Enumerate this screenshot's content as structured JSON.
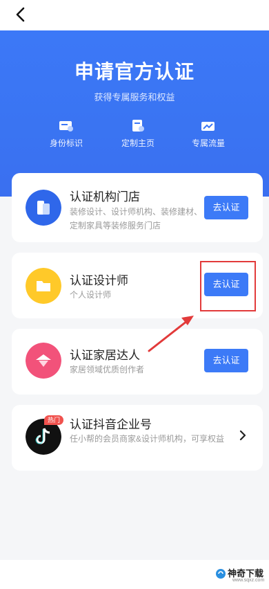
{
  "header": {
    "back_icon": "chevron-left-icon"
  },
  "hero": {
    "title": "申请官方认证",
    "subtitle": "获得专属服务和权益",
    "benefits": [
      {
        "label": "身份标识",
        "icon": "id-badge-icon"
      },
      {
        "label": "定制主页",
        "icon": "homepage-icon"
      },
      {
        "label": "专属流量",
        "icon": "trend-up-icon"
      }
    ]
  },
  "cards": [
    {
      "title": "认证机构门店",
      "desc": "装修设计、设计师机构、装修建材、定制家具等装修服务门店",
      "button": "去认证",
      "icon": "store-icon",
      "color": "#2f67ea"
    },
    {
      "title": "认证设计师",
      "desc": "个人设计师",
      "button": "去认证",
      "icon": "folder-icon",
      "color": "#ffc929"
    },
    {
      "title": "认证家居达人",
      "desc": "家居领域优质创作者",
      "button": "去认证",
      "icon": "home-star-icon",
      "color": "#f2527a"
    },
    {
      "title": "认证抖音企业号",
      "desc": "任小帮的会员商家&设计师机构，可享权益",
      "badge": "热门",
      "icon": "tiktok-icon",
      "color": "#111111"
    }
  ],
  "watermark": {
    "text": "神奇下载",
    "url": "www.sqxz.com"
  },
  "colors": {
    "accent": "#3c7af7",
    "annotation": "#e23a3a"
  }
}
